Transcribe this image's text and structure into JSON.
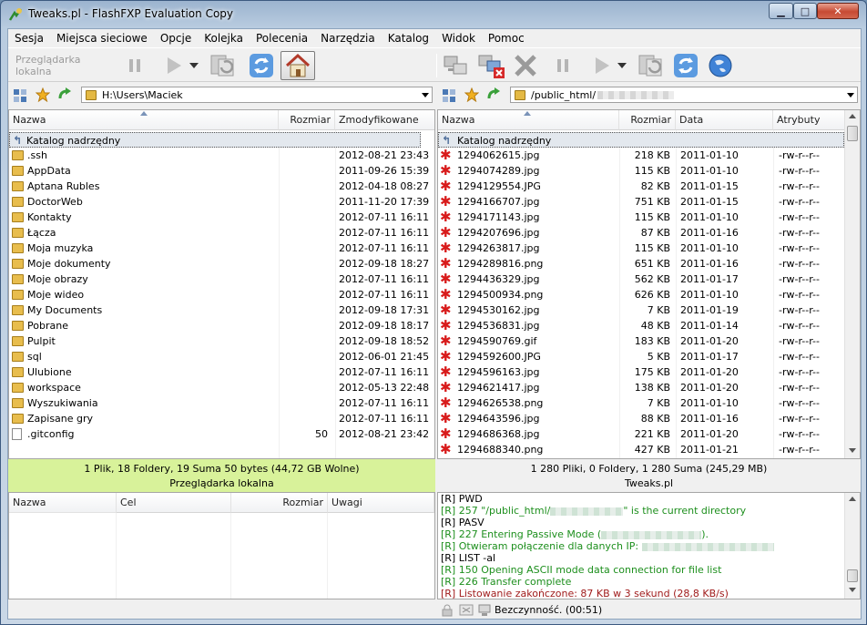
{
  "window": {
    "title": "Tweaks.pl - FlashFXP Evaluation Copy"
  },
  "menu": [
    "Sesja",
    "Miejsca sieciowe",
    "Opcje",
    "Kolejka",
    "Polecenia",
    "Narzędzia",
    "Katalog",
    "Widok",
    "Pomoc"
  ],
  "toolbar": {
    "local_browser_label": "Przeglądarka lokalna"
  },
  "local": {
    "path": "H:\\Users\\Maciek",
    "columns": {
      "name": "Nazwa",
      "size": "Rozmiar",
      "modified": "Zmodyfikowane"
    },
    "parent": "Katalog nadrzędny",
    "files": [
      {
        "name": ".ssh",
        "size": "",
        "modified": "2012-08-21 23:43",
        "icon": "folder"
      },
      {
        "name": "AppData",
        "size": "",
        "modified": "2011-09-26 15:39",
        "icon": "folder"
      },
      {
        "name": "Aptana Rubles",
        "size": "",
        "modified": "2012-04-18 08:27",
        "icon": "folder"
      },
      {
        "name": "DoctorWeb",
        "size": "",
        "modified": "2011-11-20 17:39",
        "icon": "folder"
      },
      {
        "name": "Kontakty",
        "size": "",
        "modified": "2012-07-11 16:11",
        "icon": "folder"
      },
      {
        "name": "Łącza",
        "size": "",
        "modified": "2012-07-11 16:11",
        "icon": "folder"
      },
      {
        "name": "Moja muzyka",
        "size": "",
        "modified": "2012-07-11 16:11",
        "icon": "folder"
      },
      {
        "name": "Moje dokumenty",
        "size": "",
        "modified": "2012-09-18 18:27",
        "icon": "folder"
      },
      {
        "name": "Moje obrazy",
        "size": "",
        "modified": "2012-07-11 16:11",
        "icon": "folder"
      },
      {
        "name": "Moje wideo",
        "size": "",
        "modified": "2012-07-11 16:11",
        "icon": "folder"
      },
      {
        "name": "My Documents",
        "size": "",
        "modified": "2012-09-18 17:31",
        "icon": "folder"
      },
      {
        "name": "Pobrane",
        "size": "",
        "modified": "2012-09-18 18:17",
        "icon": "folder"
      },
      {
        "name": "Pulpit",
        "size": "",
        "modified": "2012-09-18 18:52",
        "icon": "folder"
      },
      {
        "name": "sql",
        "size": "",
        "modified": "2012-06-01 21:45",
        "icon": "folder"
      },
      {
        "name": "Ulubione",
        "size": "",
        "modified": "2012-07-11 16:11",
        "icon": "folder"
      },
      {
        "name": "workspace",
        "size": "",
        "modified": "2012-05-13 22:48",
        "icon": "folder"
      },
      {
        "name": "Wyszukiwania",
        "size": "",
        "modified": "2012-07-11 16:11",
        "icon": "folder"
      },
      {
        "name": "Zapisane gry",
        "size": "",
        "modified": "2012-07-11 16:11",
        "icon": "folder"
      },
      {
        "name": ".gitconfig",
        "size": "50",
        "modified": "2012-08-21 23:42",
        "icon": "file"
      }
    ],
    "status_line1": "1 Plik, 18 Foldery, 19 Suma 50 bytes (44,72 GB Wolne)",
    "status_line2": "Przeglądarka lokalna"
  },
  "remote": {
    "path": "/public_html/",
    "columns": {
      "name": "Nazwa",
      "size": "Rozmiar",
      "date": "Data",
      "attrs": "Atrybuty"
    },
    "parent": "Katalog nadrzędny",
    "files": [
      {
        "name": "1294062615.jpg",
        "size": "218 KB",
        "date": "2011-01-10",
        "attrs": "-rw-r--r--"
      },
      {
        "name": "1294074289.jpg",
        "size": "115 KB",
        "date": "2011-01-10",
        "attrs": "-rw-r--r--"
      },
      {
        "name": "1294129554.JPG",
        "size": "82 KB",
        "date": "2011-01-15",
        "attrs": "-rw-r--r--"
      },
      {
        "name": "1294166707.jpg",
        "size": "751 KB",
        "date": "2011-01-15",
        "attrs": "-rw-r--r--"
      },
      {
        "name": "1294171143.jpg",
        "size": "115 KB",
        "date": "2011-01-10",
        "attrs": "-rw-r--r--"
      },
      {
        "name": "1294207696.jpg",
        "size": "87 KB",
        "date": "2011-01-16",
        "attrs": "-rw-r--r--"
      },
      {
        "name": "1294263817.jpg",
        "size": "115 KB",
        "date": "2011-01-10",
        "attrs": "-rw-r--r--"
      },
      {
        "name": "1294289816.png",
        "size": "651 KB",
        "date": "2011-01-16",
        "attrs": "-rw-r--r--"
      },
      {
        "name": "1294436329.jpg",
        "size": "562 KB",
        "date": "2011-01-17",
        "attrs": "-rw-r--r--"
      },
      {
        "name": "1294500934.png",
        "size": "626 KB",
        "date": "2011-01-10",
        "attrs": "-rw-r--r--"
      },
      {
        "name": "1294530162.jpg",
        "size": "7 KB",
        "date": "2011-01-19",
        "attrs": "-rw-r--r--"
      },
      {
        "name": "1294536831.jpg",
        "size": "48 KB",
        "date": "2011-01-14",
        "attrs": "-rw-r--r--"
      },
      {
        "name": "1294590769.gif",
        "size": "183 KB",
        "date": "2011-01-20",
        "attrs": "-rw-r--r--"
      },
      {
        "name": "1294592600.JPG",
        "size": "5 KB",
        "date": "2011-01-17",
        "attrs": "-rw-r--r--"
      },
      {
        "name": "1294596163.jpg",
        "size": "175 KB",
        "date": "2011-01-20",
        "attrs": "-rw-r--r--"
      },
      {
        "name": "1294621417.jpg",
        "size": "138 KB",
        "date": "2011-01-20",
        "attrs": "-rw-r--r--"
      },
      {
        "name": "1294626538.png",
        "size": "7 KB",
        "date": "2011-01-10",
        "attrs": "-rw-r--r--"
      },
      {
        "name": "1294643596.jpg",
        "size": "88 KB",
        "date": "2011-01-16",
        "attrs": "-rw-r--r--"
      },
      {
        "name": "1294686368.jpg",
        "size": "221 KB",
        "date": "2011-01-20",
        "attrs": "-rw-r--r--"
      },
      {
        "name": "1294688340.png",
        "size": "427 KB",
        "date": "2011-01-21",
        "attrs": "-rw-r--r--"
      }
    ],
    "status_line1": "1 280 Pliki, 0 Foldery, 1 280 Suma (245,29 MB)",
    "status_line2": "Tweaks.pl"
  },
  "queue": {
    "columns": {
      "name": "Nazwa",
      "target": "Cel",
      "size": "Rozmiar",
      "notes": "Uwagi"
    }
  },
  "log": [
    {
      "prefix": "[R]",
      "text": "PWD",
      "color": "#000000"
    },
    {
      "prefix": "[R]",
      "text": "257 \"/public_html/",
      "tail": "\" is the current directory",
      "color": "#1d8f1d",
      "blur": 80
    },
    {
      "prefix": "[R]",
      "text": "PASV",
      "color": "#000000"
    },
    {
      "prefix": "[R]",
      "text": "227 Entering Passive Mode (",
      "tail": ").",
      "color": "#1d8f1d",
      "blur": 110
    },
    {
      "prefix": "[R]",
      "text": "Otwieram połączenie dla danych IP: ",
      "tail": "",
      "color": "#1d8f1d",
      "blur": 145
    },
    {
      "prefix": "[R]",
      "text": "LIST -al",
      "color": "#000000"
    },
    {
      "prefix": "[R]",
      "text": "150 Opening ASCII mode data connection for file list",
      "color": "#1d8f1d"
    },
    {
      "prefix": "[R]",
      "text": "226 Transfer complete",
      "color": "#1d8f1d"
    },
    {
      "prefix": "[R]",
      "text": "Listowanie zakończone: 87 KB w 3 sekund (28,8 KB/s)",
      "color": "#a01c1c"
    }
  ],
  "statusbar": {
    "text": "Bezczynność. (00:51)"
  }
}
